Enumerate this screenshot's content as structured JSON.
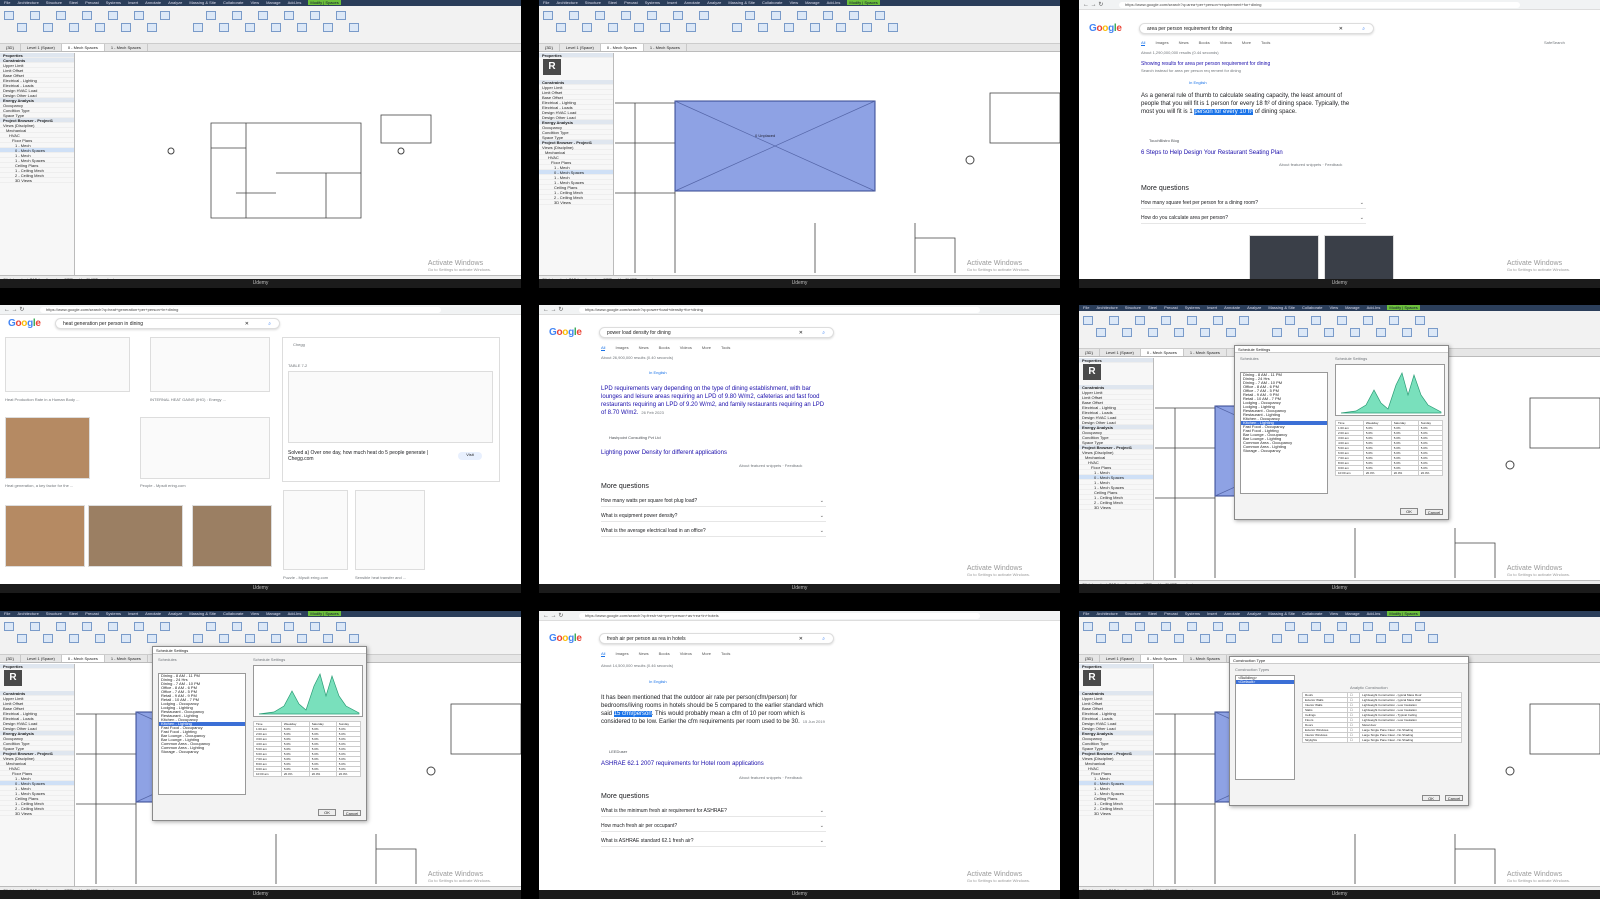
{
  "footer_label": "Udemy",
  "watermark": {
    "title": "Activate Windows",
    "subtitle": "Go to Settings to activate Windows."
  },
  "revit": {
    "menu": [
      "File",
      "Architecture",
      "Structure",
      "Steel",
      "Precast",
      "Systems",
      "Insert",
      "Annotate",
      "Analyze",
      "Massing & Site",
      "Collaborate",
      "View",
      "Manage",
      "Add-Ins",
      "Modify | Spaces"
    ],
    "view_tabs": [
      "{3D}",
      "Level 1 (Space)",
      "0 - Mech Spaces",
      "1 - Mech Spaces"
    ],
    "properties_title": "Properties",
    "browser_title": "Project Browser - Project1",
    "browser_items": [
      "Views (Discipline)",
      "Mechanical",
      "HVAC",
      "Floor Plans",
      "1 - Mech",
      "0 - Mech Spaces",
      "1 - Mech",
      "1 - Mech Spaces",
      "Ceiling Plans",
      "1 - Ceiling Mech",
      "2 - Ceiling Mech",
      "3D Views"
    ],
    "prop_rows": [
      "Constraints",
      "Upper Limit",
      "Limit Offset",
      "Base Offset",
      "Electrical - Lighting",
      "Electrical - Loads",
      "Design HVAC Load",
      "Design Other Load",
      "Energy Analysis",
      "Occupancy",
      "Condition Type",
      "Space Type"
    ],
    "space_label": "0 Unplaced",
    "status": "Click to select, TAB for alternates, CTRL adds, SHIFT unselects."
  },
  "schedule_dialog": {
    "title": "Schedule Settings",
    "list_label": "Schedules",
    "chart_label": "Schedule Settings",
    "items": [
      "Dining - 8 AM - 11 PM",
      "Dining - 24 Hrs",
      "Dining - 7 AM - 10 PM",
      "Office - 8 AM - 6 PM",
      "Office - 7 AM - 5 PM",
      "Retail - 9 AM - 9 PM",
      "Retail - 10 AM - 7 PM",
      "Lodging - Occupancy",
      "Lodging - Lighting",
      "Restaurant - Occupancy",
      "Restaurant - Lighting",
      "Kitchen - Occupancy",
      "Kitchen - Lighting",
      "Fast Food - Occupancy",
      "Fast Food - Lighting",
      "Bar Lounge - Occupancy",
      "Bar Lounge - Lighting",
      "Common Area - Occupancy",
      "Common Area - Lighting",
      "Storage - Occupancy"
    ],
    "selected_index": 12,
    "table_headers": [
      "Time",
      "Weekday",
      "Saturday",
      "Sunday"
    ],
    "table_rows": [
      [
        "1:00 am",
        "5.0%",
        "5.0%",
        "5.0%"
      ],
      [
        "2:00 am",
        "5.0%",
        "5.0%",
        "5.0%"
      ],
      [
        "3:00 am",
        "5.0%",
        "5.0%",
        "5.0%"
      ],
      [
        "4:00 am",
        "5.0%",
        "5.0%",
        "5.0%"
      ],
      [
        "5:00 am",
        "5.0%",
        "5.0%",
        "5.0%"
      ],
      [
        "6:00 am",
        "5.0%",
        "5.0%",
        "5.0%"
      ],
      [
        "7:00 am",
        "5.0%",
        "5.0%",
        "5.0%"
      ],
      [
        "8:00 am",
        "5.0%",
        "5.0%",
        "5.0%"
      ],
      [
        "9:00 am",
        "5.0%",
        "5.0%",
        "5.0%"
      ],
      [
        "10:00 am",
        "20.0%",
        "20.0%",
        "20.0%"
      ]
    ],
    "ok": "OK",
    "cancel": "Cancel"
  },
  "construction_dialog": {
    "title": "Construction Type",
    "list_label": "Construction Types",
    "items": [
      "<Building>",
      "<Default>"
    ],
    "header": "Analytic Construction",
    "rows": [
      [
        "Roofs",
        "Lightweight Construction - typical Mass Roof"
      ],
      [
        "Exterior Walls",
        "Lightweight Construction - typical Mass Wall"
      ],
      [
        "Interior Walls",
        "Lightweight Construction - Low Insulation"
      ],
      [
        "Slabs",
        "Lightweight Construction - Low Insulation"
      ],
      [
        "Ceilings",
        "Lightweight Construction - Typical Ceiling"
      ],
      [
        "Floors",
        "Lightweight Construction - Low Insulation"
      ],
      [
        "Doors",
        "Metal door"
      ],
      [
        "Exterior Windows",
        "Large Single Pane Clear - No Shading"
      ],
      [
        "Interior Windows",
        "Large Single Pane Clear - No Shading"
      ],
      [
        "Skylights",
        "Large Single Pane Clear - No Shading"
      ]
    ],
    "ok": "OK",
    "cancel": "Cancel"
  },
  "google": {
    "logo": [
      "G",
      "o",
      "o",
      "g",
      "l",
      "e"
    ],
    "tabs": [
      "All",
      "Images",
      "News",
      "Books",
      "Videos",
      "More"
    ],
    "tools": "Tools",
    "safesearch": "SafeSearch",
    "q1": {
      "url": "https://www.google.com/search?q=area+per+person+requirement+for+dining",
      "query": "area per person requirement for dining",
      "results": "About 1,290,000,000 results (0.44 seconds)",
      "showing": "Showing results for area per person requirement for dining",
      "instead": "Search instead for area per person req rement for dining",
      "lang": "In English",
      "snippet_a": "As a general rule of thumb to calculate seating capacity, the least amount of people that you will fit is 1 person for every 18 ft² of dining space. Typically, the most you will fit is 1 ",
      "snippet_mark": "person for every 10 ft²",
      "snippet_b": " of dining space.",
      "source": "TouchBistro Blog",
      "link": "6 Steps to Help Design Your Restaurant Seating Plan",
      "feedback": "About featured snippets · Feedback",
      "paa": "More questions",
      "questions": [
        "How many square feet per person for a dining room?",
        "How do you calculate area per person?"
      ]
    },
    "q2": {
      "url": "https://www.google.com/search?q=heat+generation+per+person+in+dining",
      "query": "heat generation per person in dining",
      "panel_source": "Chegg",
      "panel_table": "TABLE 7-2",
      "panel_title": "Solved a) Over one day, how much heat do 5 people generate | Chegg.com",
      "visit": "Visit",
      "captions": [
        "Heat Production Rate in a Human Body ...",
        "INTERNAL HEAT GAINS (IHG) : Energy ...",
        "Heat generation, a key factor for the ...",
        "People - Mpsdt ering.com",
        "Puzzle - Mpsdt ering.com",
        "Sensible heat transfer and ..."
      ]
    },
    "q3": {
      "url": "https://www.google.com/search?q=power+load+density+for+dining",
      "query": "power load density for dining",
      "results": "About 26,900,000 results (0.40 seconds)",
      "lang": "In English",
      "snippet": "LPD requirements vary depending on the type of dining establishment, with bar lounges and leisure areas requiring an LPD of 9.80 W/m2, cafeterias and fast food restaurants requiring an LPD of 9.20 W/m2, and family restaurants requiring an LPD of 8.70 W/m2.",
      "date": "26 Feb 2023",
      "source": "Hashpoint Consulting Pvt Ltd",
      "link": "Lighting power Density for different applications",
      "feedback": "About featured snippets · Feedback",
      "paa": "More questions",
      "questions": [
        "How many watts per square foot plug load?",
        "What is equipment power density?",
        "What is the average electrical load in an office?"
      ]
    },
    "q4": {
      "url": "https://www.google.com/search?q=fresh+air+per+person+as+rea+in+hotels",
      "query": "fresh air per person as rea in hotels",
      "results": "About 14,500,000 results (0.46 seconds)",
      "lang": "In English",
      "snippet_a": "It has been mentioned that the outdoor air rate per person(cfm/person) for bedrooms/living rooms in hotels should be 5 compared to the earlier standard which said ",
      "snippet_mark": "15 cfm/person",
      "snippet_b": ". This would probably mean a cfm of 10 per room which is considered to be low. Earlier the cfm requirements per room used to be 30.",
      "date": "15 Jun 2019",
      "source": "LEEDuser",
      "link": "ASHRAE 62.1 2007 requirements for Hotel room applications",
      "feedback": "About featured snippets · Feedback",
      "paa": "More questions",
      "questions": [
        "What is the minimum fresh air requirement for ASHRAE?",
        "How much fresh air per occupant?",
        "What is ASHRAE standard 62.1 fresh air?"
      ]
    }
  },
  "colors": {
    "space_fill": "#8ea2e4",
    "chart_fill": "#79e0bc",
    "highlight": "#1a73e8",
    "revit_title": "#2b3e5a"
  }
}
